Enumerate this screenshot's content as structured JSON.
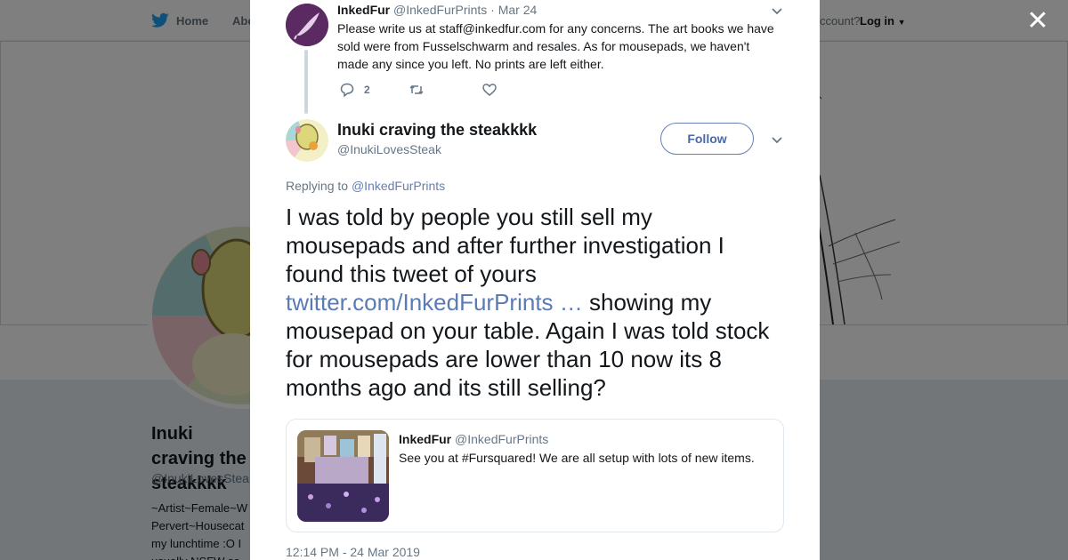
{
  "topbar": {
    "home_label": "Home",
    "about_label": "Abo",
    "account_prompt": "ccount?",
    "login_label": "Log in"
  },
  "background_profile": {
    "name": "Inuki craving the steakkkk",
    "handle": "@InukiLovesSteak",
    "bio": "~Artist~Female~W Pervert~Housecat my lunchtime :O I usually NSFW so"
  },
  "modal": {
    "close_label": "✕",
    "parent_tweet": {
      "name": "InkedFur",
      "handle": "@InkedFurPrints",
      "date": "· Mar 24",
      "text": "Please write us at staff@inkedfur.com for any concerns. The art books we have sold were from Fusselschwarm and resales. As for mousepads, we haven't made any since you left. No prints are left either.",
      "reply_count": "2",
      "retweet_count": "",
      "like_count": ""
    },
    "main_tweet": {
      "name": "Inuki craving the steakkkk",
      "handle": "@InukiLovesSteak",
      "follow_label": "Follow",
      "replying_prefix": "Replying to",
      "replying_to": "@InkedFurPrints",
      "text_part1": "I was told by people you still sell my mousepads and after further investigation I found this tweet of yours ",
      "link": "twitter.com/InkedFurPrints …",
      "text_part2": " showing my mousepad on your table. Again I was told stock for mousepads are lower than 10 now its 8 months ago and its still selling?",
      "timestamp": "12:14 PM - 24 Mar 2019"
    },
    "quoted_tweet": {
      "name": "InkedFur",
      "handle": "@InkedFurPrints",
      "text": "See you at #Fursquared! We are all setup with lots of new items."
    }
  },
  "colors": {
    "link": "#5b7bb4",
    "muted": "#657786",
    "twitter_blue": "#1da1f2",
    "overlay": "rgba(0,0,0,0.5)"
  }
}
